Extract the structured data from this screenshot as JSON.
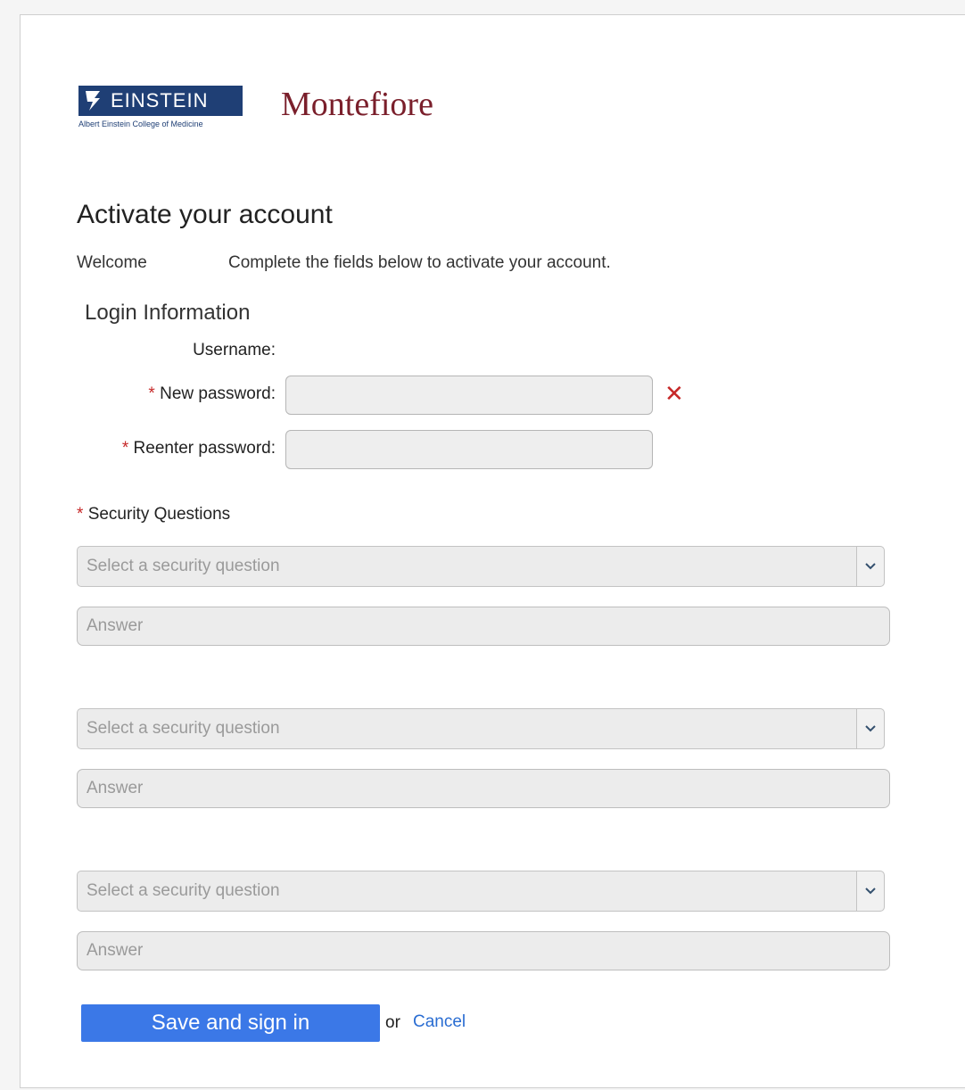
{
  "logos": {
    "einstein_word": "EINSTEIN",
    "einstein_sub": "Albert Einstein College of Medicine",
    "montefiore": "Montefiore"
  },
  "page": {
    "title": "Activate your account",
    "welcome": "Welcome",
    "instructions": "Complete the fields below to activate your account."
  },
  "login": {
    "heading": "Login Information",
    "username_label": "Username:",
    "new_password_label": "New password:",
    "reenter_password_label": "Reenter password:",
    "required_mark": "*",
    "error_icon": "close-icon"
  },
  "security": {
    "heading": "Security Questions",
    "questions": [
      {
        "select_placeholder": "Select a security question",
        "answer_placeholder": "Answer"
      },
      {
        "select_placeholder": "Select a security question",
        "answer_placeholder": "Answer"
      },
      {
        "select_placeholder": "Select a security question",
        "answer_placeholder": "Answer"
      }
    ]
  },
  "actions": {
    "save_label": "Save and sign in",
    "or_text": "or",
    "cancel_label": "Cancel"
  },
  "colors": {
    "brand_navy": "#1f3f75",
    "brand_maroon": "#7a1f2b",
    "primary_button": "#3b78e7",
    "link": "#2a6dd2",
    "error": "#c62828"
  }
}
